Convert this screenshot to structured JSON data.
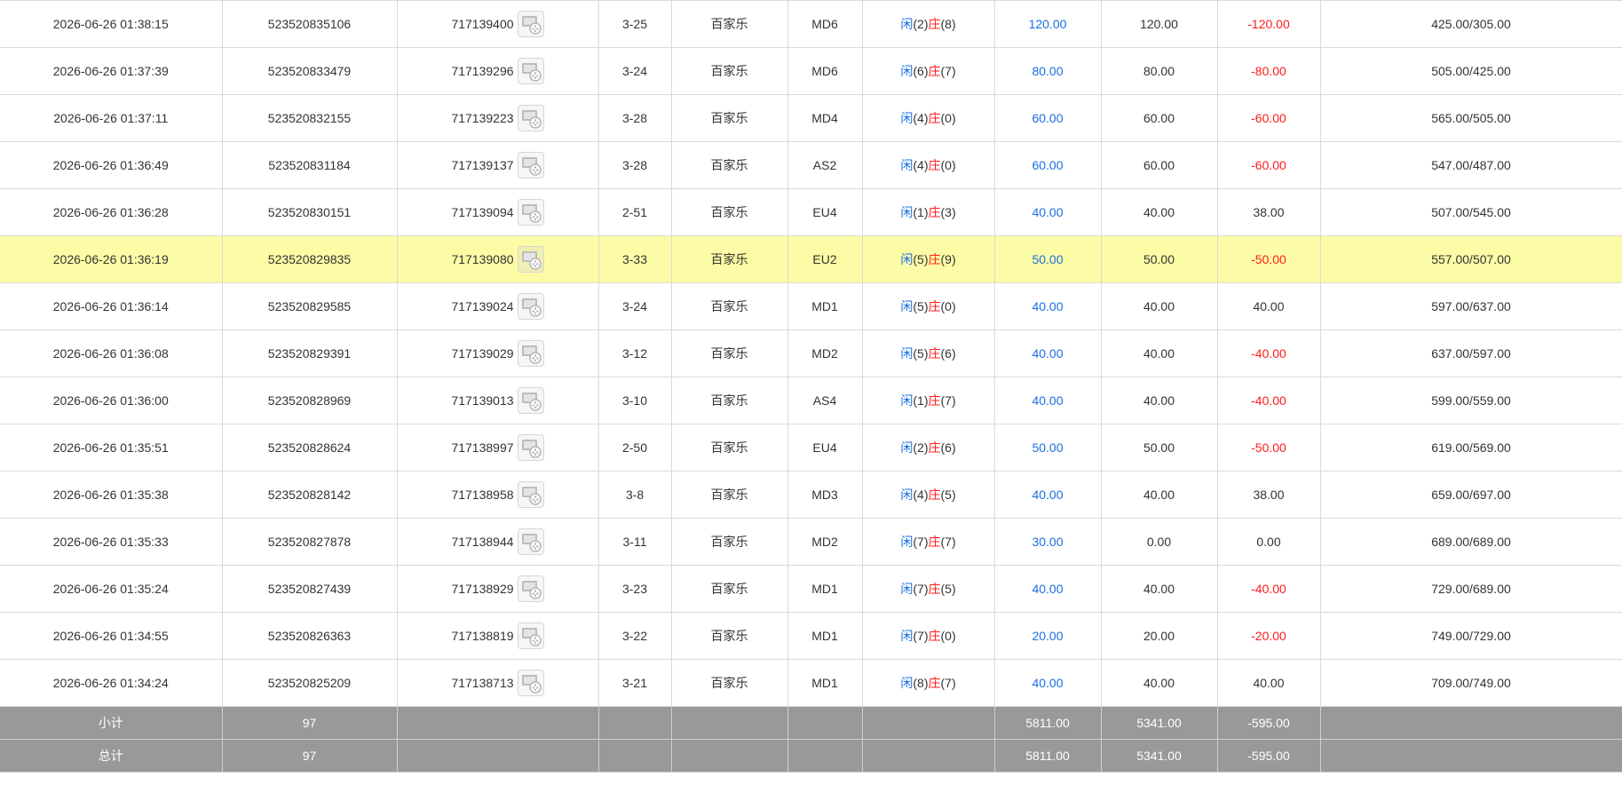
{
  "rows": [
    {
      "time": "2026-06-26 01:38:15",
      "order": "523520835106",
      "round": "717139400",
      "shoe": "3-25",
      "game": "百家乐",
      "table": "MD6",
      "p_label": "闲",
      "p_val": "(2)",
      "b_label": "庄",
      "b_val": "(8)",
      "bet": "120.00",
      "valid": "120.00",
      "win": "-120.00",
      "win_color": "red",
      "balance": "425.00/305.00"
    },
    {
      "time": "2026-06-26 01:37:39",
      "order": "523520833479",
      "round": "717139296",
      "shoe": "3-24",
      "game": "百家乐",
      "table": "MD6",
      "p_label": "闲",
      "p_val": "(6)",
      "b_label": "庄",
      "b_val": "(7)",
      "bet": "80.00",
      "valid": "80.00",
      "win": "-80.00",
      "win_color": "red",
      "balance": "505.00/425.00"
    },
    {
      "time": "2026-06-26 01:37:11",
      "order": "523520832155",
      "round": "717139223",
      "shoe": "3-28",
      "game": "百家乐",
      "table": "MD4",
      "p_label": "闲",
      "p_val": "(4)",
      "b_label": "庄",
      "b_val": "(0)",
      "bet": "60.00",
      "valid": "60.00",
      "win": "-60.00",
      "win_color": "red",
      "balance": "565.00/505.00"
    },
    {
      "time": "2026-06-26 01:36:49",
      "order": "523520831184",
      "round": "717139137",
      "shoe": "3-28",
      "game": "百家乐",
      "table": "AS2",
      "p_label": "闲",
      "p_val": "(4)",
      "b_label": "庄",
      "b_val": "(0)",
      "bet": "60.00",
      "valid": "60.00",
      "win": "-60.00",
      "win_color": "red",
      "balance": "547.00/487.00"
    },
    {
      "time": "2026-06-26 01:36:28",
      "order": "523520830151",
      "round": "717139094",
      "shoe": "2-51",
      "game": "百家乐",
      "table": "EU4",
      "p_label": "闲",
      "p_val": "(1)",
      "b_label": "庄",
      "b_val": "(3)",
      "bet": "40.00",
      "valid": "40.00",
      "win": "38.00",
      "win_color": "black",
      "balance": "507.00/545.00"
    },
    {
      "time": "2026-06-26 01:36:19",
      "order": "523520829835",
      "round": "717139080",
      "shoe": "3-33",
      "game": "百家乐",
      "table": "EU2",
      "p_label": "闲",
      "p_val": "(5)",
      "b_label": "庄",
      "b_val": "(9)",
      "bet": "50.00",
      "valid": "50.00",
      "win": "-50.00",
      "win_color": "red",
      "balance": "557.00/507.00",
      "highlight": true
    },
    {
      "time": "2026-06-26 01:36:14",
      "order": "523520829585",
      "round": "717139024",
      "shoe": "3-24",
      "game": "百家乐",
      "table": "MD1",
      "p_label": "闲",
      "p_val": "(5)",
      "b_label": "庄",
      "b_val": "(0)",
      "bet": "40.00",
      "valid": "40.00",
      "win": "40.00",
      "win_color": "black",
      "balance": "597.00/637.00"
    },
    {
      "time": "2026-06-26 01:36:08",
      "order": "523520829391",
      "round": "717139029",
      "shoe": "3-12",
      "game": "百家乐",
      "table": "MD2",
      "p_label": "闲",
      "p_val": "(5)",
      "b_label": "庄",
      "b_val": "(6)",
      "bet": "40.00",
      "valid": "40.00",
      "win": "-40.00",
      "win_color": "red",
      "balance": "637.00/597.00"
    },
    {
      "time": "2026-06-26 01:36:00",
      "order": "523520828969",
      "round": "717139013",
      "shoe": "3-10",
      "game": "百家乐",
      "table": "AS4",
      "p_label": "闲",
      "p_val": "(1)",
      "b_label": "庄",
      "b_val": "(7)",
      "bet": "40.00",
      "valid": "40.00",
      "win": "-40.00",
      "win_color": "red",
      "balance": "599.00/559.00"
    },
    {
      "time": "2026-06-26 01:35:51",
      "order": "523520828624",
      "round": "717138997",
      "shoe": "2-50",
      "game": "百家乐",
      "table": "EU4",
      "p_label": "闲",
      "p_val": "(2)",
      "b_label": "庄",
      "b_val": "(6)",
      "bet": "50.00",
      "valid": "50.00",
      "win": "-50.00",
      "win_color": "red",
      "balance": "619.00/569.00"
    },
    {
      "time": "2026-06-26 01:35:38",
      "order": "523520828142",
      "round": "717138958",
      "shoe": "3-8",
      "game": "百家乐",
      "table": "MD3",
      "p_label": "闲",
      "p_val": "(4)",
      "b_label": "庄",
      "b_val": "(5)",
      "bet": "40.00",
      "valid": "40.00",
      "win": "38.00",
      "win_color": "black",
      "balance": "659.00/697.00"
    },
    {
      "time": "2026-06-26 01:35:33",
      "order": "523520827878",
      "round": "717138944",
      "shoe": "3-11",
      "game": "百家乐",
      "table": "MD2",
      "p_label": "闲",
      "p_val": "(7)",
      "b_label": "庄",
      "b_val": "(7)",
      "bet": "30.00",
      "valid": "0.00",
      "win": "0.00",
      "win_color": "black",
      "balance": "689.00/689.00"
    },
    {
      "time": "2026-06-26 01:35:24",
      "order": "523520827439",
      "round": "717138929",
      "shoe": "3-23",
      "game": "百家乐",
      "table": "MD1",
      "p_label": "闲",
      "p_val": "(7)",
      "b_label": "庄",
      "b_val": "(5)",
      "bet": "40.00",
      "valid": "40.00",
      "win": "-40.00",
      "win_color": "red",
      "balance": "729.00/689.00"
    },
    {
      "time": "2026-06-26 01:34:55",
      "order": "523520826363",
      "round": "717138819",
      "shoe": "3-22",
      "game": "百家乐",
      "table": "MD1",
      "p_label": "闲",
      "p_val": "(7)",
      "b_label": "庄",
      "b_val": "(0)",
      "bet": "20.00",
      "valid": "20.00",
      "win": "-20.00",
      "win_color": "red",
      "balance": "749.00/729.00"
    },
    {
      "time": "2026-06-26 01:34:24",
      "order": "523520825209",
      "round": "717138713",
      "shoe": "3-21",
      "game": "百家乐",
      "table": "MD1",
      "p_label": "闲",
      "p_val": "(8)",
      "b_label": "庄",
      "b_val": "(7)",
      "bet": "40.00",
      "valid": "40.00",
      "win": "40.00",
      "win_color": "black",
      "balance": "709.00/749.00"
    }
  ],
  "summary": [
    {
      "label": "小计",
      "count": "97",
      "bet": "5811.00",
      "valid": "5341.00",
      "win": "-595.00"
    },
    {
      "label": "总计",
      "count": "97",
      "bet": "5811.00",
      "valid": "5341.00",
      "win": "-595.00"
    }
  ],
  "colors": {
    "player": "#1a6fe0",
    "banker": "#ff1a1a",
    "highlight": "#fdfca6",
    "summary_bg": "#999999"
  },
  "icons": {
    "detail": "video-replay-icon"
  }
}
